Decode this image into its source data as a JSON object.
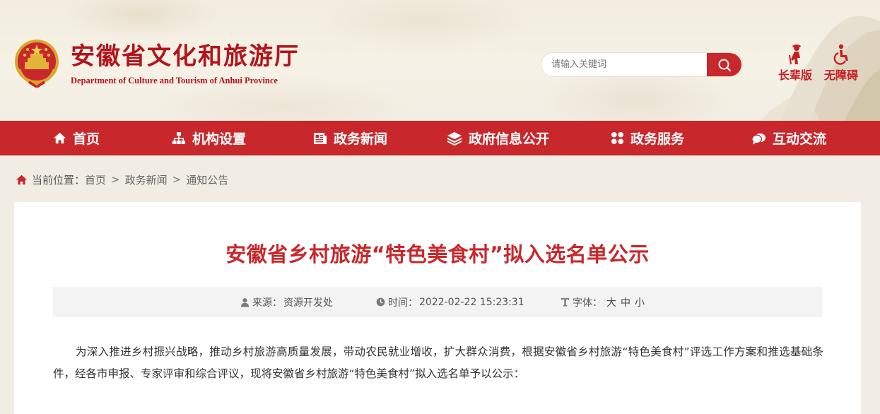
{
  "header": {
    "title": "安徽省文化和旅游厅",
    "subtitle": "Department of Culture and Tourism of Anhui Province",
    "search": {
      "placeholder": "请输入关键词"
    },
    "tools": [
      {
        "label": "长辈版",
        "icon": "elder-icon"
      },
      {
        "label": "无障碍",
        "icon": "wheelchair-icon"
      }
    ]
  },
  "nav": {
    "items": [
      {
        "label": "首页",
        "icon": "home-icon"
      },
      {
        "label": "机构设置",
        "icon": "org-chart-icon"
      },
      {
        "label": "政务新闻",
        "icon": "news-icon"
      },
      {
        "label": "政府信息公开",
        "icon": "layers-icon"
      },
      {
        "label": "政务服务",
        "icon": "grid-icon"
      },
      {
        "label": "互动交流",
        "icon": "chat-icon"
      }
    ]
  },
  "breadcrumb": {
    "prefix": "当前位置：",
    "items": [
      "首页",
      "政务新闻",
      "通知公告"
    ],
    "separator": ">"
  },
  "article": {
    "title": "安徽省乡村旅游“特色美食村”拟入选名单公示",
    "meta": {
      "source_label": "来源：",
      "source": "资源开发处",
      "time_label": "时间：",
      "time": "2022-02-22 15:23:31",
      "fontsize_label": "字体：",
      "font_sizes": [
        "大",
        "中",
        "小"
      ]
    },
    "paragraph": "为深入推进乡村振兴战略，推动乡村旅游高质量发展，带动农民就业增收，扩大群众消费，根据安徽省乡村旅游“特色美食村”评选工作方案和推选基础条件，经各市申报、专家评审和综合评议，现将安徽省乡村旅游“特色美食村”拟入选名单予以公示："
  },
  "colors": {
    "brand_red": "#c8282c",
    "title_red": "#b3141b",
    "header_bg": "#f3ede0"
  }
}
